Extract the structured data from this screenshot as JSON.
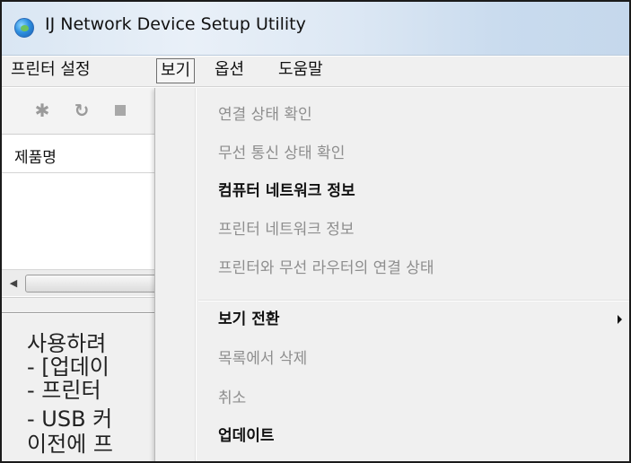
{
  "window": {
    "title": "IJ Network Device Setup Utility",
    "icon": "app-globe-icon"
  },
  "menubar": {
    "items": [
      {
        "label": "프린터 설정"
      },
      {
        "label": "보기"
      },
      {
        "label": "옵션"
      },
      {
        "label": "도움말"
      }
    ],
    "active_index": 1
  },
  "toolbar": {
    "icons": [
      "gear-icon",
      "refresh-icon",
      "stop-icon"
    ],
    "glyphs": {
      "gear": "✱",
      "refresh": "↻"
    }
  },
  "product_list": {
    "column_header": "제품명"
  },
  "description": {
    "lines": [
      "사용하려",
      "- [업데이",
      "- 프린터",
      "- USB 커",
      "이전에 프"
    ]
  },
  "view_menu": {
    "items": [
      {
        "label": "연결 상태 확인",
        "enabled": false
      },
      {
        "label": "무선 통신 상태 확인",
        "enabled": false
      },
      {
        "label": "컴퓨터 네트워크 정보",
        "enabled": true
      },
      {
        "label": "프린터 네트워크 정보",
        "enabled": false
      },
      {
        "label": "프린터와 무선 라우터의 연결 상태",
        "enabled": false
      },
      {
        "label": "보기 전환",
        "enabled": true,
        "submenu": true
      },
      {
        "label": "목록에서 삭제",
        "enabled": false
      },
      {
        "label": "취소",
        "enabled": false
      },
      {
        "label": "업데이트",
        "enabled": true
      }
    ]
  },
  "colors": {
    "menu_background": "#f0f0f0",
    "disabled_text": "#8e8e8e",
    "enabled_text": "#111111"
  }
}
